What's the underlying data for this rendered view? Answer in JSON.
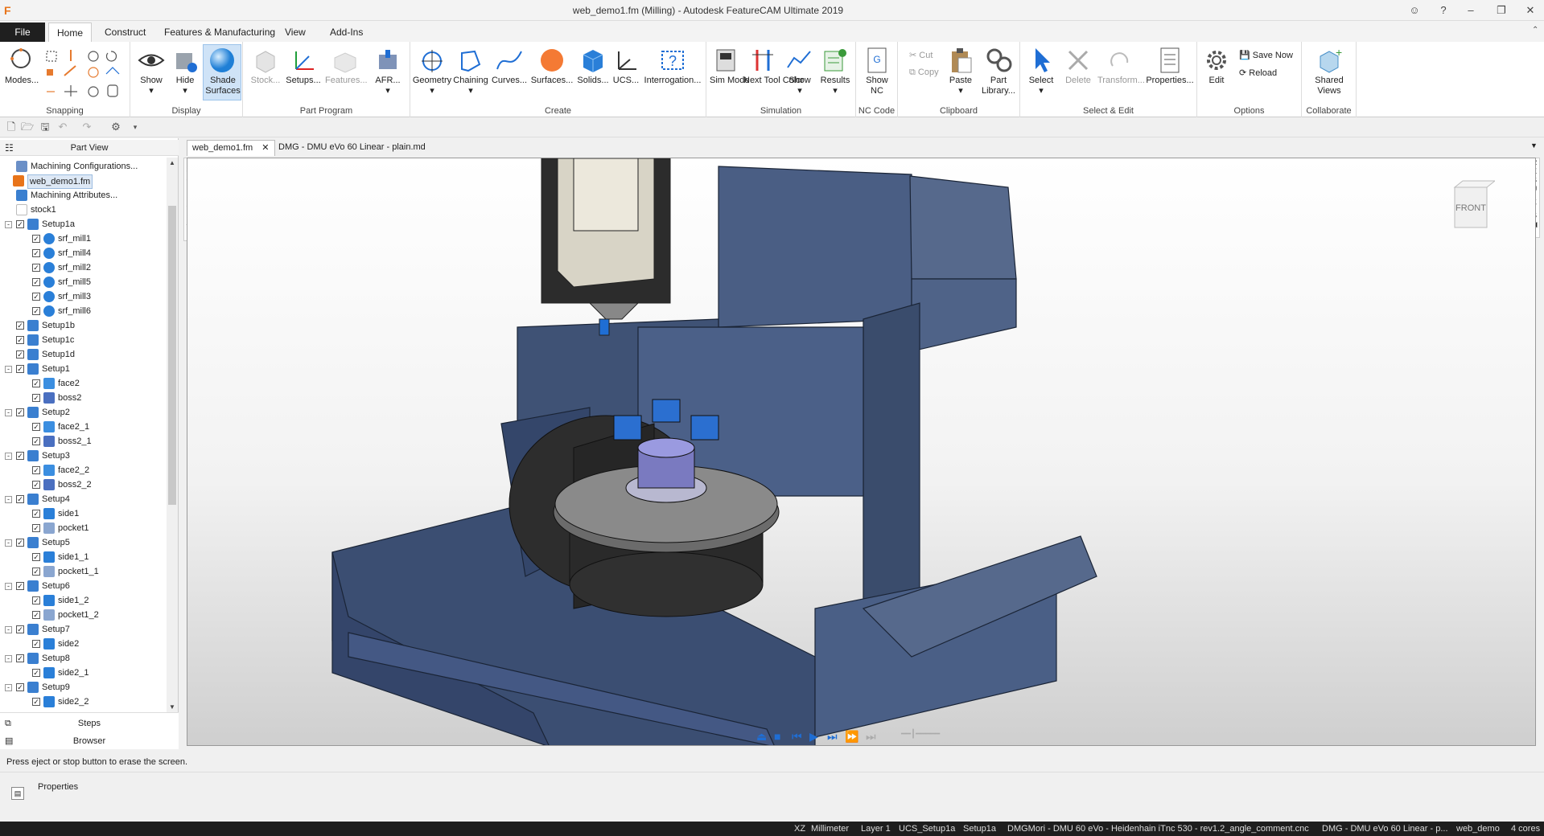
{
  "window": {
    "title": "web_demo1.fm (Milling) - Autodesk FeatureCAM Ultimate 2019",
    "app_icon": "F"
  },
  "ribbon_tabs": [
    {
      "label": "File"
    },
    {
      "label": "Home"
    },
    {
      "label": "Construct"
    },
    {
      "label": "Features & Manufacturing"
    },
    {
      "label": "View"
    },
    {
      "label": "Add-Ins"
    }
  ],
  "ribbon": {
    "modes": "Modes...",
    "show": "Show",
    "hide": "Hide",
    "shade_surfaces": "Shade Surfaces",
    "stock": "Stock...",
    "setups": "Setups...",
    "features": "Features...",
    "afr": "AFR...",
    "geometry": "Geometry",
    "chaining": "Chaining",
    "curves": "Curves...",
    "surfaces": "Surfaces...",
    "solids": "Solids...",
    "ucs": "UCS...",
    "interrogation": "Interrogation...",
    "sim_mode": "Sim Mode",
    "next_tool_color": "Next Tool Color",
    "sim_show": "Show",
    "results": "Results",
    "show_nc": "Show NC",
    "cut": "Cut",
    "copy": "Copy",
    "paste": "Paste",
    "part_library": "Part Library...",
    "select": "Select",
    "delete": "Delete",
    "transform": "Transform...",
    "properties": "Properties...",
    "edit": "Edit",
    "save_now": "Save Now",
    "reload": "Reload",
    "shared_views": "Shared Views",
    "groups": {
      "snapping": "Snapping",
      "display": "Display",
      "part_program": "Part Program",
      "create": "Create",
      "simulation": "Simulation",
      "nc_code": "NC Code",
      "clipboard": "Clipboard",
      "select_edit": "Select & Edit",
      "options": "Options",
      "collaborate": "Collaborate"
    }
  },
  "part_view": {
    "title": "Part View",
    "tree": [
      {
        "label": "Machining Configurations...",
        "level": 1,
        "kind": "config"
      },
      {
        "label": "web_demo1.fm",
        "level": 0,
        "kind": "file",
        "selected": true
      },
      {
        "label": "Machining Attributes...",
        "level": 1,
        "kind": "attr"
      },
      {
        "label": "stock1",
        "level": 1,
        "kind": "stock"
      },
      {
        "label": "Setup1a",
        "level": 1,
        "kind": "setup",
        "expand": "-"
      },
      {
        "label": "srf_mill1",
        "level": 2,
        "kind": "surf"
      },
      {
        "label": "srf_mill4",
        "level": 2,
        "kind": "surf"
      },
      {
        "label": "srf_mill2",
        "level": 2,
        "kind": "surf"
      },
      {
        "label": "srf_mill5",
        "level": 2,
        "kind": "surf"
      },
      {
        "label": "srf_mill3",
        "level": 2,
        "kind": "surf"
      },
      {
        "label": "srf_mill6",
        "level": 2,
        "kind": "surf"
      },
      {
        "label": "Setup1b",
        "level": 1,
        "kind": "setup"
      },
      {
        "label": "Setup1c",
        "level": 1,
        "kind": "setup"
      },
      {
        "label": "Setup1d",
        "level": 1,
        "kind": "setup"
      },
      {
        "label": "Setup1",
        "level": 1,
        "kind": "setup",
        "expand": "-"
      },
      {
        "label": "face2",
        "level": 2,
        "kind": "face"
      },
      {
        "label": "boss2",
        "level": 2,
        "kind": "boss"
      },
      {
        "label": "Setup2",
        "level": 1,
        "kind": "setup",
        "expand": "-"
      },
      {
        "label": "face2_1",
        "level": 2,
        "kind": "face"
      },
      {
        "label": "boss2_1",
        "level": 2,
        "kind": "boss"
      },
      {
        "label": "Setup3",
        "level": 1,
        "kind": "setup",
        "expand": "-"
      },
      {
        "label": "face2_2",
        "level": 2,
        "kind": "face"
      },
      {
        "label": "boss2_2",
        "level": 2,
        "kind": "boss"
      },
      {
        "label": "Setup4",
        "level": 1,
        "kind": "setup",
        "expand": "-"
      },
      {
        "label": "side1",
        "level": 2,
        "kind": "side"
      },
      {
        "label": "pocket1",
        "level": 2,
        "kind": "pocket"
      },
      {
        "label": "Setup5",
        "level": 1,
        "kind": "setup",
        "expand": "-"
      },
      {
        "label": "side1_1",
        "level": 2,
        "kind": "side"
      },
      {
        "label": "pocket1_1",
        "level": 2,
        "kind": "pocket"
      },
      {
        "label": "Setup6",
        "level": 1,
        "kind": "setup",
        "expand": "-"
      },
      {
        "label": "side1_2",
        "level": 2,
        "kind": "side"
      },
      {
        "label": "pocket1_2",
        "level": 2,
        "kind": "pocket"
      },
      {
        "label": "Setup7",
        "level": 1,
        "kind": "setup",
        "expand": "-"
      },
      {
        "label": "side2",
        "level": 2,
        "kind": "side"
      },
      {
        "label": "Setup8",
        "level": 1,
        "kind": "setup",
        "expand": "-"
      },
      {
        "label": "side2_1",
        "level": 2,
        "kind": "side"
      },
      {
        "label": "Setup9",
        "level": 1,
        "kind": "setup",
        "expand": "-"
      },
      {
        "label": "side2_2",
        "level": 2,
        "kind": "side"
      }
    ],
    "steps": "Steps",
    "browser": "Browser"
  },
  "doc_tabs": [
    {
      "label": "web_demo1.fm",
      "active": true
    },
    {
      "label": "DMG - DMU eVo 60 Linear - plain.md",
      "active": false
    }
  ],
  "toolbox_label": "TOOLBOX",
  "results_label": "RESULTS",
  "viewcube_label": "FRONT",
  "status_message": "Press eject or stop button to erase the screen.",
  "properties_label": "Properties",
  "statusbar": {
    "plane": "XZ",
    "units": "Millimeter",
    "layer": "Layer 1",
    "ucs": "UCS_Setup1a",
    "setup": "Setup1a",
    "post": "DMGMori - DMU 60 eVo - Heidenhain iTnc 530 - rev1.2_angle_comment.cnc",
    "machine": "DMG - DMU eVo 60 Linear - p...",
    "user": "web_demo",
    "cores": "4 cores"
  },
  "colors": {
    "accent": "#1f6ed4",
    "machine_body": "#3f5275",
    "dark_bar": "#1e1e1e"
  }
}
